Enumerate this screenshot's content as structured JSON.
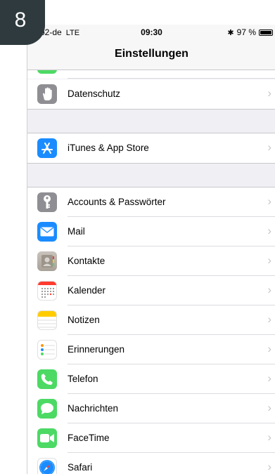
{
  "step_badge": "8",
  "status_bar": {
    "carrier": "o2-de",
    "network": "LTE",
    "time": "09:30",
    "bluetooth": "✱",
    "battery": "97 %",
    "battery_level": 0.97
  },
  "nav": {
    "title": "Einstellungen"
  },
  "rows": [
    {
      "label": "Datenschutz",
      "icon": "hand-icon",
      "color": "#8e8e93"
    },
    {
      "label": "iTunes & App Store",
      "icon": "app-store-icon",
      "color": "#1a8cff"
    },
    {
      "label": "Accounts & Passwörter",
      "icon": "key-icon",
      "color": "#8e8e93"
    },
    {
      "label": "Mail",
      "icon": "mail-icon",
      "color": "#1a8cff"
    },
    {
      "label": "Kontakte",
      "icon": "contacts-icon",
      "color": "#b7b0a8"
    },
    {
      "label": "Kalender",
      "icon": "calendar-icon",
      "color": "#ffffff"
    },
    {
      "label": "Notizen",
      "icon": "notes-icon",
      "color": "#ffffff"
    },
    {
      "label": "Erinnerungen",
      "icon": "reminders-icon",
      "color": "#ffffff"
    },
    {
      "label": "Telefon",
      "icon": "phone-icon",
      "color": "#4cd964"
    },
    {
      "label": "Nachrichten",
      "icon": "messages-icon",
      "color": "#4cd964"
    },
    {
      "label": "FaceTime",
      "icon": "facetime-icon",
      "color": "#4cd964"
    },
    {
      "label": "Safari",
      "icon": "safari-icon",
      "color": "#1a8cff"
    }
  ],
  "chevron": "›"
}
